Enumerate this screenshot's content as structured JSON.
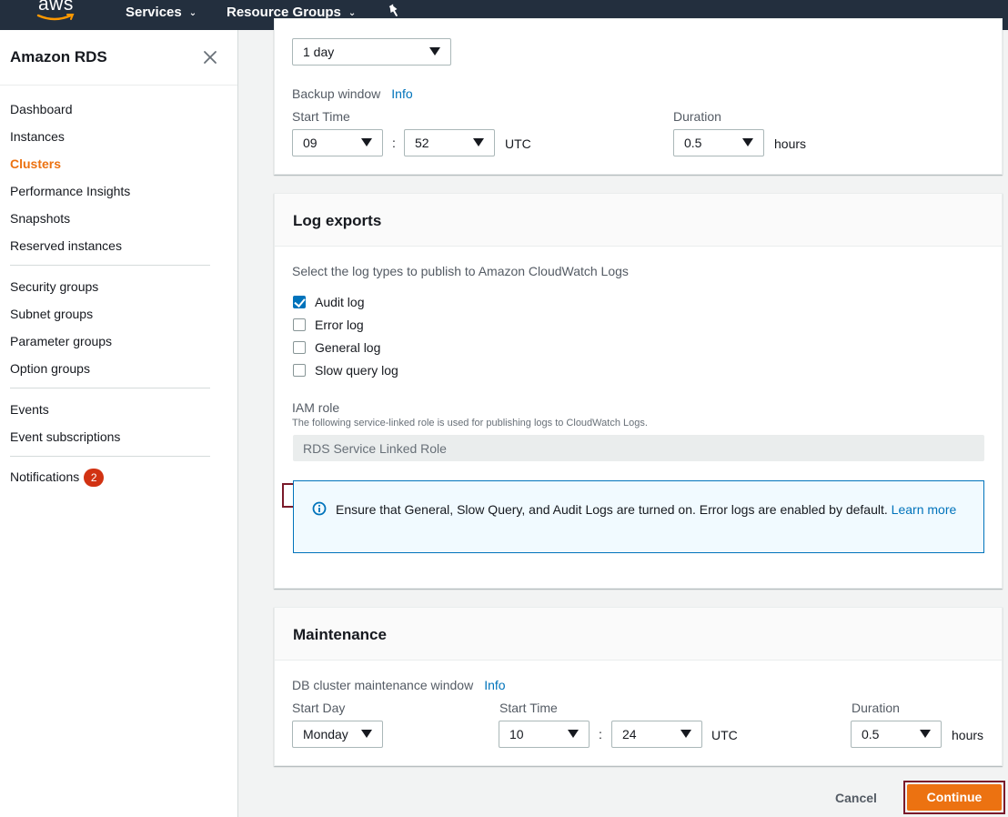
{
  "topnav": {
    "logo_text": "aws",
    "services_label": "Services",
    "resource_groups_label": "Resource Groups"
  },
  "sidebar": {
    "title": "Amazon RDS",
    "items": [
      {
        "label": "Dashboard"
      },
      {
        "label": "Instances"
      },
      {
        "label": "Clusters",
        "active": true
      },
      {
        "label": "Performance Insights"
      },
      {
        "label": "Snapshots"
      },
      {
        "label": "Reserved instances"
      },
      {
        "label": "Security groups"
      },
      {
        "label": "Subnet groups"
      },
      {
        "label": "Parameter groups"
      },
      {
        "label": "Option groups"
      },
      {
        "label": "Events"
      },
      {
        "label": "Event subscriptions"
      },
      {
        "label": "Notifications",
        "badge": "2"
      }
    ]
  },
  "backup": {
    "retention_value": "1 day",
    "window_label": "Backup window",
    "info": "Info",
    "start_time_label": "Start Time",
    "hour": "09",
    "minute": "52",
    "tz": "UTC",
    "duration_label": "Duration",
    "duration": "0.5",
    "hours_unit": "hours"
  },
  "log_exports": {
    "title": "Log exports",
    "description": "Select the log types to publish to Amazon CloudWatch Logs",
    "options": [
      {
        "label": "Audit log",
        "checked": true
      },
      {
        "label": "Error log",
        "checked": false
      },
      {
        "label": "General log",
        "checked": false
      },
      {
        "label": "Slow query log",
        "checked": false
      }
    ],
    "iam_role_label": "IAM role",
    "iam_role_desc": "The following service-linked role is used for publishing logs to CloudWatch Logs.",
    "iam_role_value": "RDS Service Linked Role",
    "alert_text": "Ensure that General, Slow Query, and Audit Logs are turned on. Error logs are enabled by default.",
    "alert_link": "Learn more"
  },
  "maintenance": {
    "title": "Maintenance",
    "window_label": "DB cluster maintenance window",
    "info": "Info",
    "start_day_label": "Start Day",
    "start_day": "Monday",
    "start_time_label": "Start Time",
    "hour": "10",
    "minute": "24",
    "tz": "UTC",
    "duration_label": "Duration",
    "duration": "0.5",
    "hours_unit": "hours"
  },
  "footer": {
    "cancel": "Cancel",
    "continue": "Continue"
  },
  "colors": {
    "nav_bg": "#232f3e",
    "accent": "#ec7211",
    "link": "#0073bb",
    "badge": "#d13212",
    "highlight": "#7a1a2a"
  }
}
